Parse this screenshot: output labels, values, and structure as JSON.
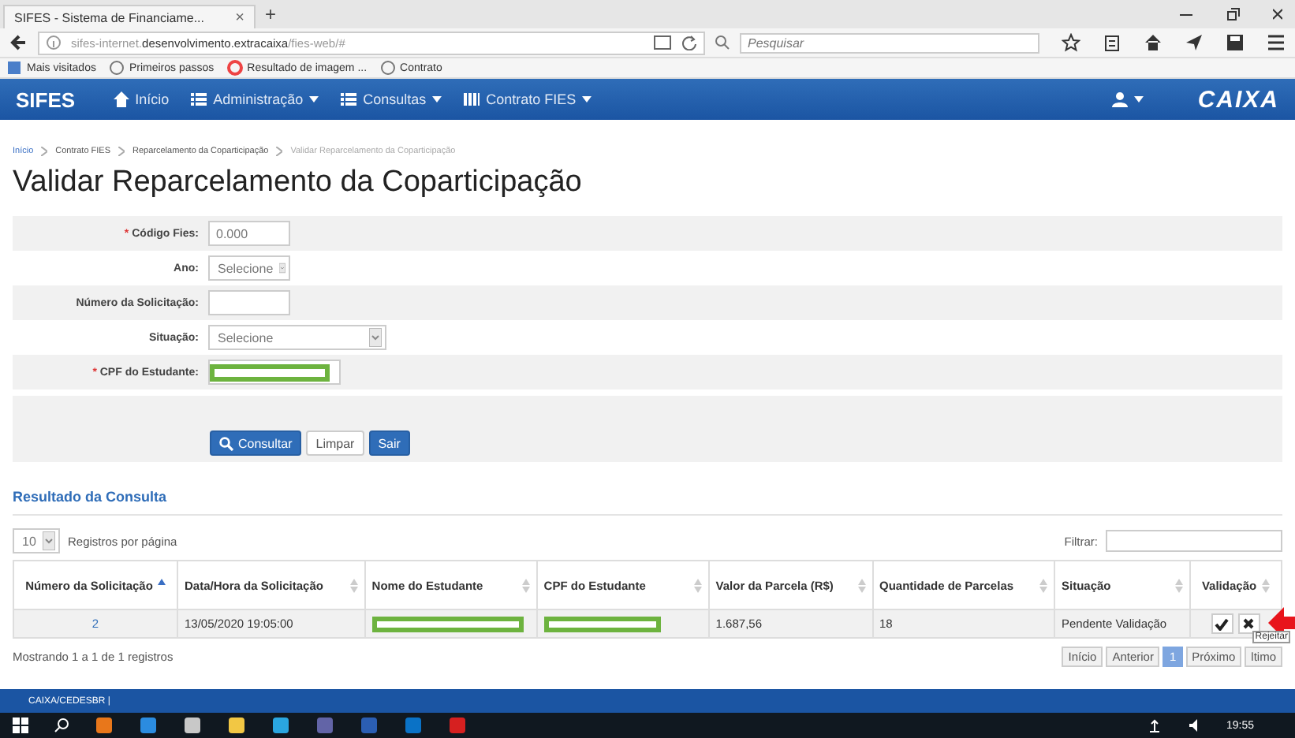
{
  "browser": {
    "tab_title": "SIFES - Sistema de Financiame...",
    "tab_close": "×",
    "new_tab": "+",
    "url_prefix": "sifes-internet.",
    "url_host": "desenvolvimento.extracaixa",
    "url_path": "/fies-web/#",
    "search_placeholder": "Pesquisar",
    "bookmarks": [
      "Mais visitados",
      "Primeiros passos",
      "Resultado de imagem ...",
      "Contrato"
    ]
  },
  "navbar": {
    "brand": "SIFES",
    "items": [
      {
        "label": "Início",
        "kind": "home",
        "dropdown": false
      },
      {
        "label": "Administração",
        "kind": "list",
        "dropdown": true
      },
      {
        "label": "Consultas",
        "kind": "list",
        "dropdown": true
      },
      {
        "label": "Contrato FIES",
        "kind": "grid",
        "dropdown": true
      }
    ],
    "logo": "CAIXA"
  },
  "breadcrumb": [
    {
      "label": "Início",
      "current": false
    },
    {
      "label": "Contrato FIES",
      "current": false
    },
    {
      "label": "Reparcelamento da Coparticipação",
      "current": false
    },
    {
      "label": "Validar Reparcelamento da Coparticipação",
      "current": true
    }
  ],
  "title": "Validar Reparcelamento da Coparticipação",
  "form": {
    "fields": [
      {
        "label": "Código Fies:",
        "required_mark": "*",
        "kind": "text",
        "value": "0.000"
      },
      {
        "label": "Ano:",
        "kind": "select-small",
        "value": "Selecione"
      },
      {
        "label": "Número da Solicitação:",
        "kind": "text"
      },
      {
        "label": "Situação:",
        "kind": "select",
        "value": "Selecione"
      },
      {
        "label": "CPF do Estudante:",
        "required_mark": "*",
        "kind": "redacted"
      }
    ],
    "buttons": [
      {
        "label": "Consultar",
        "kind": "primary",
        "icon": true
      },
      {
        "label": "Limpar",
        "kind": "default",
        "icon": false
      },
      {
        "label": "Sair",
        "kind": "primary",
        "icon": false
      }
    ]
  },
  "results": {
    "title": "Resultado da Consulta",
    "page_size": "10",
    "page_size_label": "Registros por página",
    "filter_label": "Filtrar:",
    "columns": [
      {
        "label": "Número da Solicitação",
        "sorted": true
      },
      {
        "label": "Data/Hora da Solicitação",
        "sorted": false
      },
      {
        "label": "Nome do Estudante",
        "sorted": false
      },
      {
        "label": "CPF do Estudante",
        "sorted": false
      },
      {
        "label": "Valor da Parcela (R$)",
        "sorted": false
      },
      {
        "label": "Quantidade de Parcelas",
        "sorted": false
      },
      {
        "label": "Situação",
        "sorted": false
      },
      {
        "label": "Validação",
        "sorted": false
      }
    ],
    "rows": [
      {
        "number": "2",
        "datetime": "13/05/2020 19:05:00",
        "value": "1.687,56",
        "installments": "18",
        "status": "Pendente Validação"
      }
    ],
    "tooltip": "Rejeitar",
    "info": "Mostrando 1 a 1 de 1 registros",
    "pages": [
      {
        "label": "Início",
        "selected": false
      },
      {
        "label": "Anterior",
        "selected": false
      },
      {
        "label": "1",
        "selected": true
      },
      {
        "label": "Próximo",
        "selected": false
      },
      {
        "label": "ltimo",
        "selected": false
      }
    ]
  },
  "footer": {
    "text": "CAIXA/CEDESBR |"
  },
  "taskbar": {
    "time": "19:55"
  }
}
